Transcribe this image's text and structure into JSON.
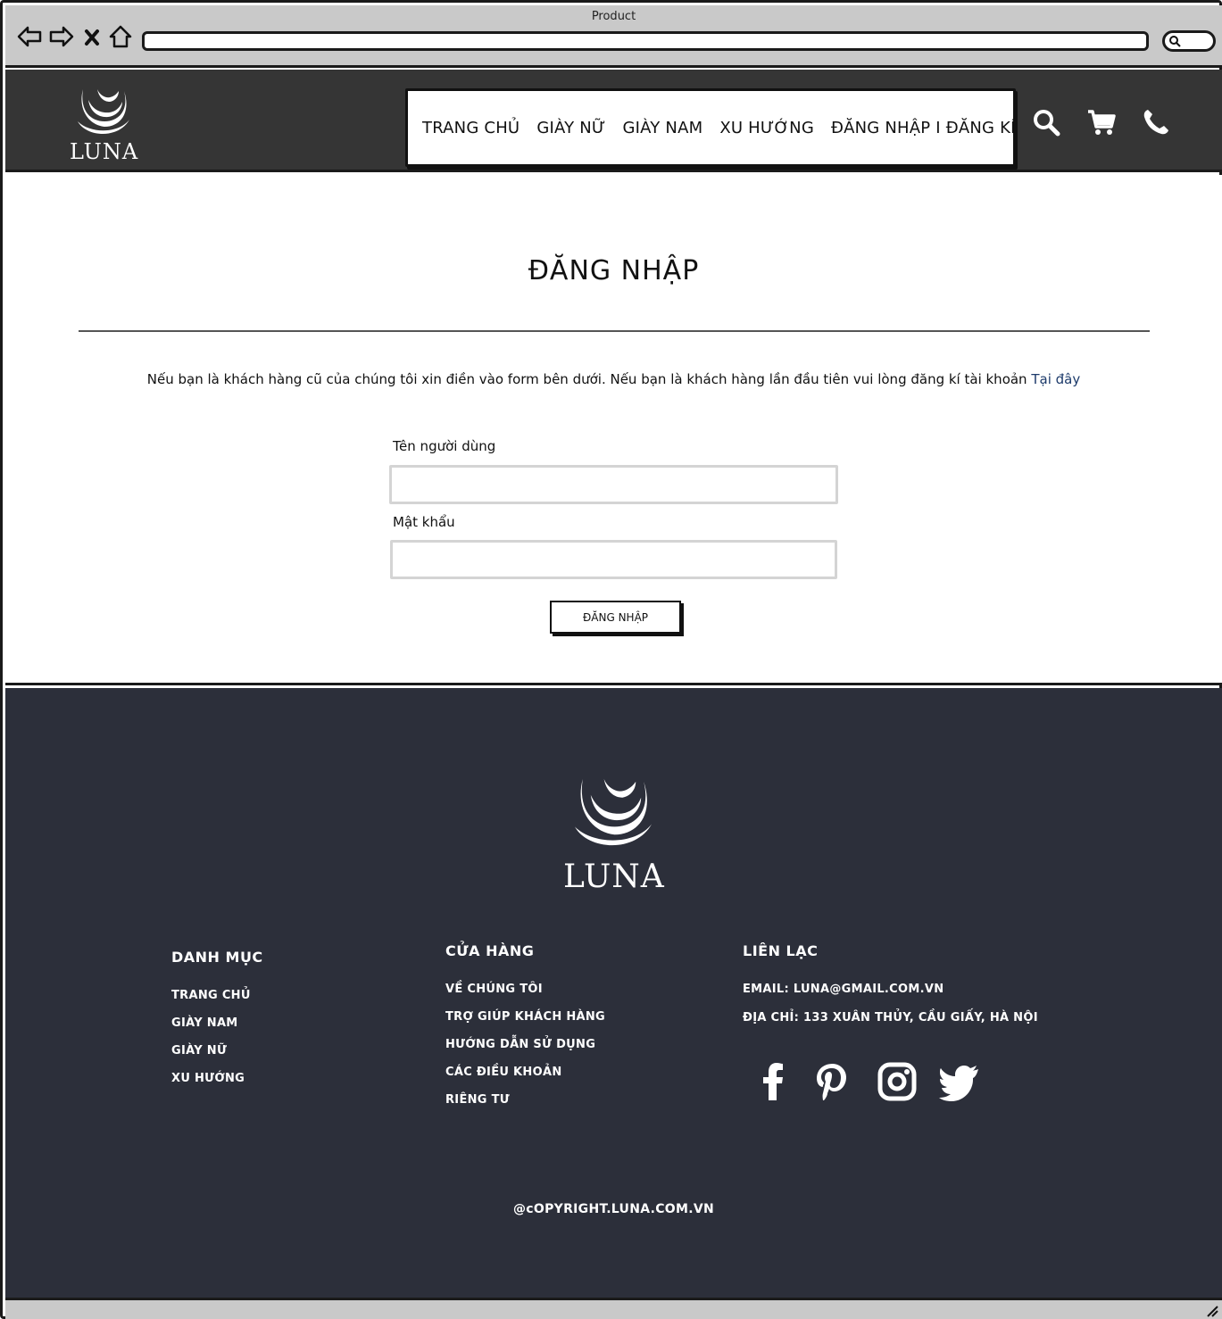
{
  "window": {
    "title": "Product"
  },
  "header": {
    "logo_text": "LUNA",
    "nav": [
      {
        "label": "TRANG CHỦ"
      },
      {
        "label": "GIÀY NỮ"
      },
      {
        "label": "GIÀY NAM"
      },
      {
        "label": "XU HƯỚNG"
      },
      {
        "label": "ĐĂNG NHẬP I ĐĂNG KÍ"
      }
    ],
    "icons": [
      "search-icon",
      "cart-icon",
      "phone-icon"
    ]
  },
  "main": {
    "title": "ĐĂNG NHẬP",
    "intro": "Nếu bạn là khách hàng cũ của chúng tôi xin điền vào form bên dưới. Nếu bạn là khách hàng lần đầu tiên vui lòng đăng kí tài khoản ",
    "intro_link": "Tại đây",
    "username_label": "Tên người dùng",
    "username_value": "",
    "password_label": "Mật khẩu",
    "password_value": "",
    "login_button": "ĐĂNG NHẬP"
  },
  "footer": {
    "logo_text": "LUNA",
    "categories": {
      "heading": "DANH MỤC",
      "links": [
        "TRANG CHỦ",
        "GIÀY NAM",
        "GIÀY NỮ",
        "XU HƯỚNG"
      ]
    },
    "store": {
      "heading": "CỬA HÀNG",
      "links": [
        "VỀ CHÚNG TÔI",
        "TRỢ GIÚP KHÁCH HÀNG",
        "HƯỚNG DẪN SỬ DỤNG",
        "CÁC ĐIỀU KHOẢN",
        "RIÊNG TƯ"
      ]
    },
    "contact": {
      "heading": "LIÊN LẠC",
      "email": "EMAIL: LUNA@GMAIL.COM.VN",
      "address": "ĐỊA CHỈ: 133 XUÂN THỦY, CẦU GIẤY, HÀ NỘI"
    },
    "social": [
      "facebook-icon",
      "pinterest-icon",
      "instagram-icon",
      "twitter-icon"
    ],
    "copyright": "@cOPYRIGHT.LUNA.COM.VN"
  },
  "colors": {
    "header_bg": "#353535",
    "footer_bg": "#2c2f3a",
    "link": "#1d3b6b",
    "chrome": "#c9c9c9"
  }
}
